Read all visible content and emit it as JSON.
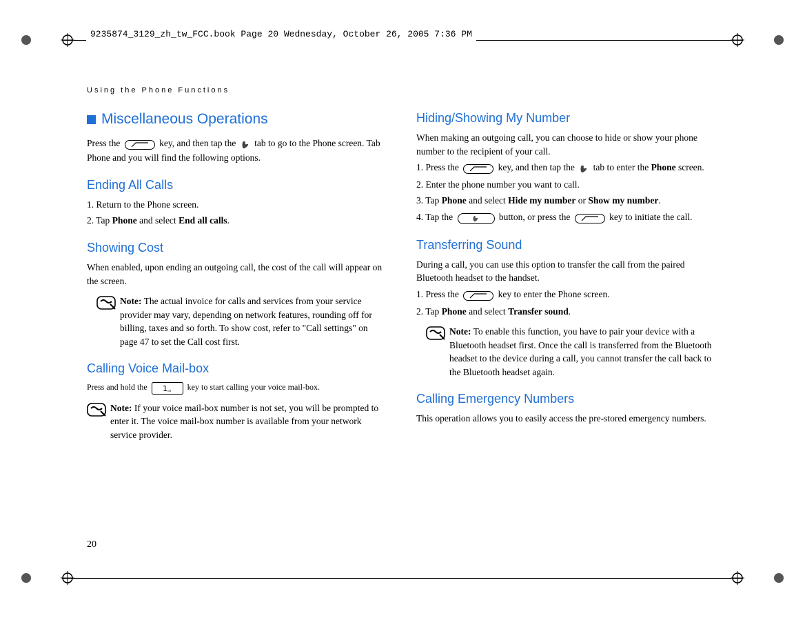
{
  "header_stamp": "9235874_3129_zh_tw_FCC.book  Page 20  Wednesday, October 26, 2005  7:36 PM",
  "running_head": "Using the Phone Functions",
  "page_number": "20",
  "left": {
    "main_heading": "Miscellaneous Operations",
    "intro_a": "Press the ",
    "intro_b": " key, and then tap the ",
    "intro_c": " tab to go to the Phone screen. Tab Phone and you will find the following options.",
    "s1_h": "Ending All Calls",
    "s1_1": "1. Return to the Phone screen.",
    "s1_2_a": "2. Tap ",
    "s1_2_b": "Phone",
    "s1_2_c": " and select ",
    "s1_2_d": "End all calls",
    "s1_2_e": ".",
    "s2_h": "Showing Cost",
    "s2_p": "When enabled, upon ending an outgoing call, the cost of the call will appear on the screen.",
    "s2_note_lbl": "Note:",
    "s2_note": " The actual invoice for calls and services from your service provider may vary, depending on network features, rounding off for billing, taxes and so forth. To show cost, refer to \"Call settings\" on page 47 to set the Call cost first.",
    "s3_h": "Calling Voice Mail-box",
    "s3_p_a": "Press and hold the ",
    "s3_p_b": " key to start calling your voice mail-box.",
    "s3_note_lbl": "Note:",
    "s3_note": " If your voice mail-box number is not set, you will be prompted to enter it. The voice mail-box number is available from your network service provider."
  },
  "right": {
    "s4_h": "Hiding/Showing My Number",
    "s4_p": "When making an outgoing call, you can choose to hide or show your phone number to the recipient of your call.",
    "s4_1_a": "1. Press the ",
    "s4_1_b": " key, and then tap the ",
    "s4_1_c": " tab to enter the ",
    "s4_1_d": "Phone",
    "s4_1_e": " screen.",
    "s4_2": "2. Enter the phone number you want to call.",
    "s4_3_a": "3. Tap ",
    "s4_3_b": "Phone",
    "s4_3_c": " and select ",
    "s4_3_d": "Hide my number",
    "s4_3_e": " or ",
    "s4_3_f": "Show my number",
    "s4_3_g": ".",
    "s4_4_a": "4. Tap the ",
    "s4_4_b": " button, or press the ",
    "s4_4_c": " key to initiate the call.",
    "s5_h": "Transferring Sound",
    "s5_p": "During a call, you can use this option to transfer the call from the paired Bluetooth headset to the handset.",
    "s5_1_a": "1. Press the ",
    "s5_1_b": " key to enter the Phone screen.",
    "s5_2_a": "2. Tap ",
    "s5_2_b": "Phone",
    "s5_2_c": " and select ",
    "s5_2_d": "Transfer sound",
    "s5_2_e": ".",
    "s5_note_lbl": "Note:",
    "s5_note": " To enable this function, you have to pair your device with a Bluetooth headset first. Once the call is transferred from the Bluetooth headset to the device during a call, you cannot transfer the call back to the Bluetooth headset again.",
    "s6_h": "Calling Emergency Numbers",
    "s6_p": "This operation allows you to easily access the pre-stored emergency numbers."
  }
}
